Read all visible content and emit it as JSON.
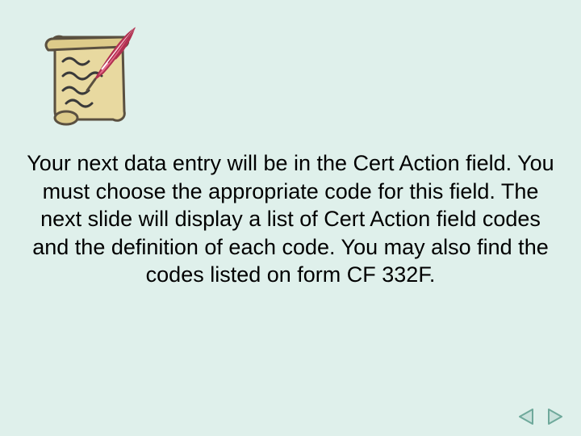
{
  "body_text": "Your next data entry will be in the Cert Action field. You must choose the appropriate code for this field. The next slide will display a list of Cert Action field codes and the definition of each code. You may also find the codes listed on form CF 332F.",
  "icons": {
    "scroll_quill": "scroll-quill-icon",
    "prev": "triangle-left",
    "next": "triangle-right"
  },
  "colors": {
    "bg": "#dff0eb",
    "nav_fill": "#c9e2dc",
    "nav_stroke": "#6fa99b",
    "scroll_fill": "#e8d9a0",
    "scroll_stroke": "#5a5040",
    "quill_pink": "#e46a8a",
    "quill_dark": "#b03050"
  }
}
